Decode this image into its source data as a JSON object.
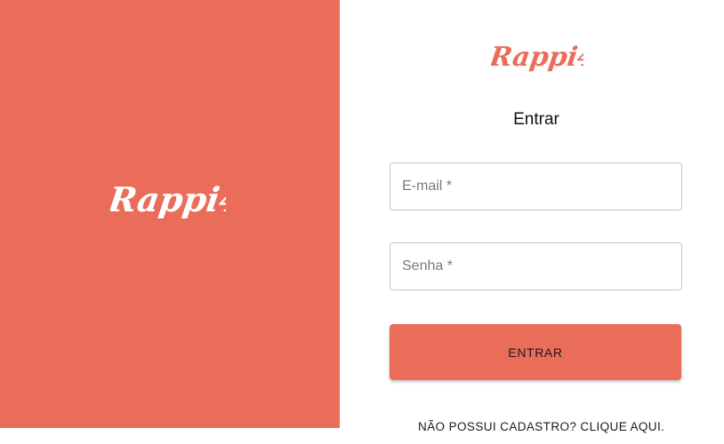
{
  "brand": {
    "logo_text": "Rappi4",
    "accent_color": "#e96d59"
  },
  "login_form": {
    "title": "Entrar",
    "email_placeholder": "E-mail *",
    "password_placeholder": "Senha *",
    "submit_label": "ENTRAR",
    "signup_link": "NÃO POSSUI CADASTRO? CLIQUE AQUI."
  }
}
